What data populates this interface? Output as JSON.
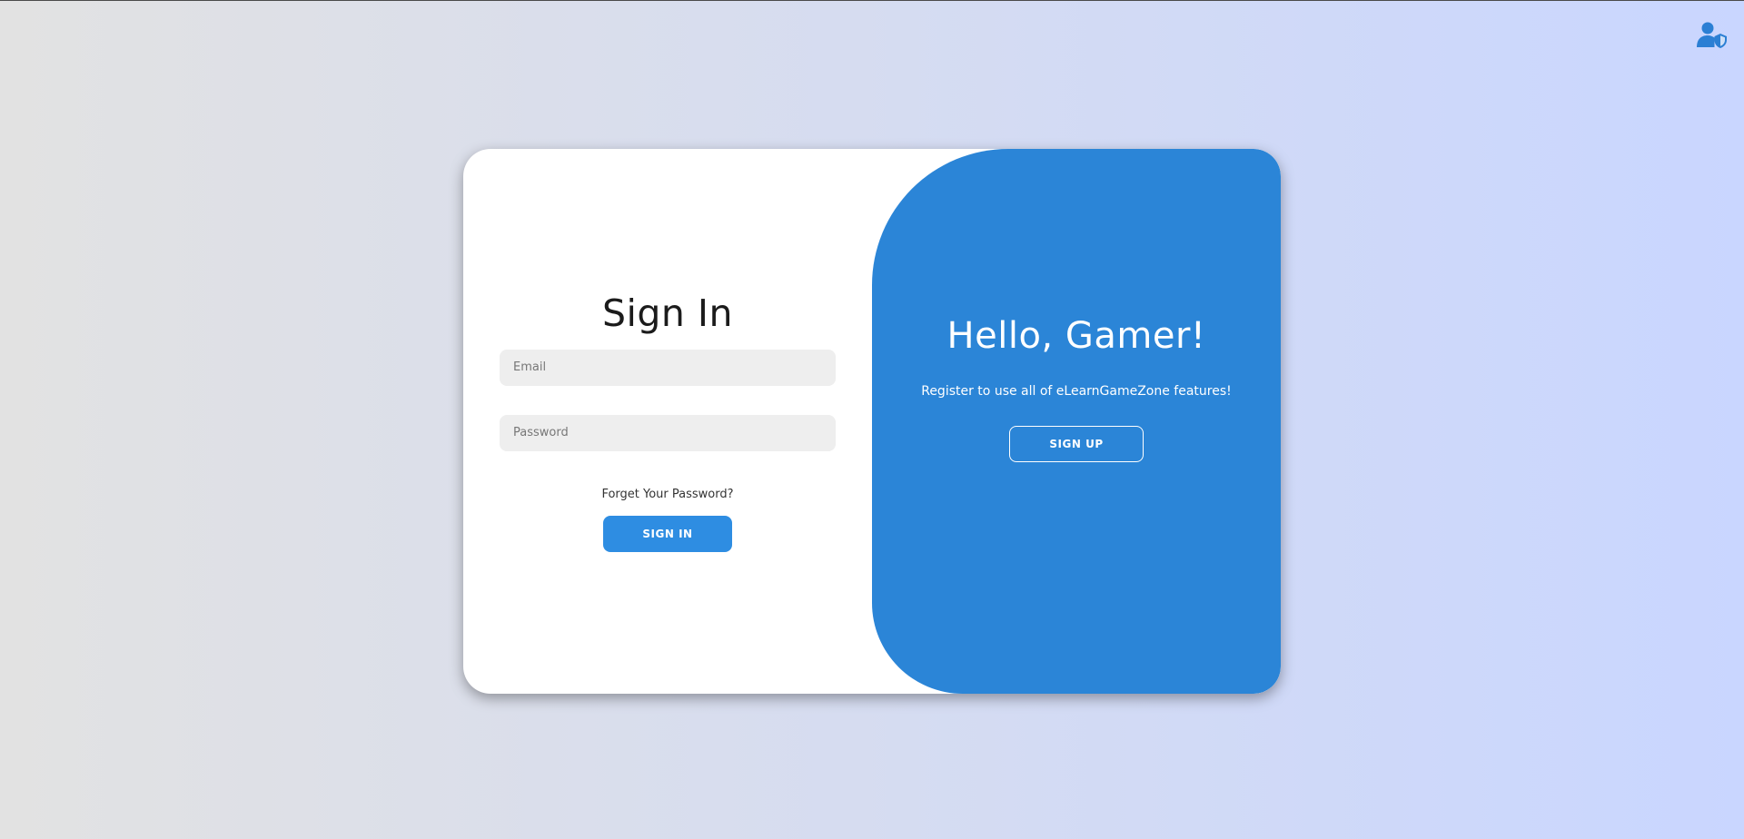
{
  "header": {
    "admin_icon": "user-shield-icon"
  },
  "sign_in": {
    "title": "Sign In",
    "email_placeholder": "Email",
    "email_value": "",
    "password_placeholder": "Password",
    "password_value": "",
    "forget_label": "Forget Your Password?",
    "button_label": "SIGN IN"
  },
  "toggle": {
    "title": "Hello, Gamer!",
    "text": "Register to use all of eLearnGameZone features!",
    "button_label": "SIGN UP"
  },
  "colors": {
    "accent": "#2e8de2",
    "panel": "#2b85d7",
    "bg_start": "#e2e2e2",
    "bg_end": "#c9d6ff"
  }
}
